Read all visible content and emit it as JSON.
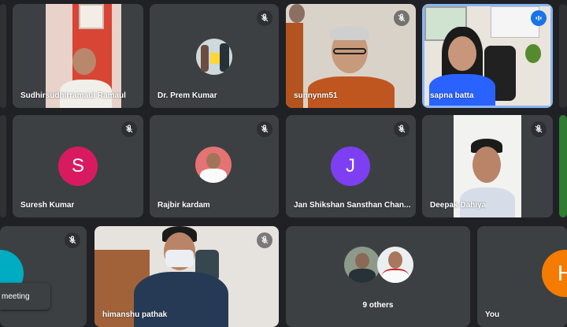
{
  "participants": {
    "p1": {
      "name": "Sudhirsudhirramaul Ramaul",
      "muted": false
    },
    "p2": {
      "name": "Dr. Prem Kumar",
      "muted": true
    },
    "p3": {
      "name": "sunnynm51",
      "muted": true
    },
    "p4": {
      "name": "sapna batta",
      "speaking": true
    },
    "p5": {
      "name": "Suresh Kumar",
      "initial": "S",
      "color": "#d81b60",
      "muted": true
    },
    "p6": {
      "name": "Rajbir kardam",
      "muted": true
    },
    "p7": {
      "name": "Jan Shikshan Sansthan Chan...",
      "initial": "J",
      "color": "#7e3ff2",
      "muted": true
    },
    "p8": {
      "name": "Deepak Dahiya",
      "muted": true
    },
    "p9": {
      "name": "himanshu pathak",
      "muted": true
    },
    "others": {
      "label": "9 others"
    },
    "you": {
      "name": "You",
      "initial": "H",
      "color": "#f57c00"
    }
  },
  "partial_tile": {
    "meeting_label": "meeting",
    "color": "#00acc1"
  },
  "colors": {
    "background": "#202124",
    "tile": "#3c4043",
    "active_border": "#8ab4f8",
    "speaking": "#1a73e8"
  }
}
